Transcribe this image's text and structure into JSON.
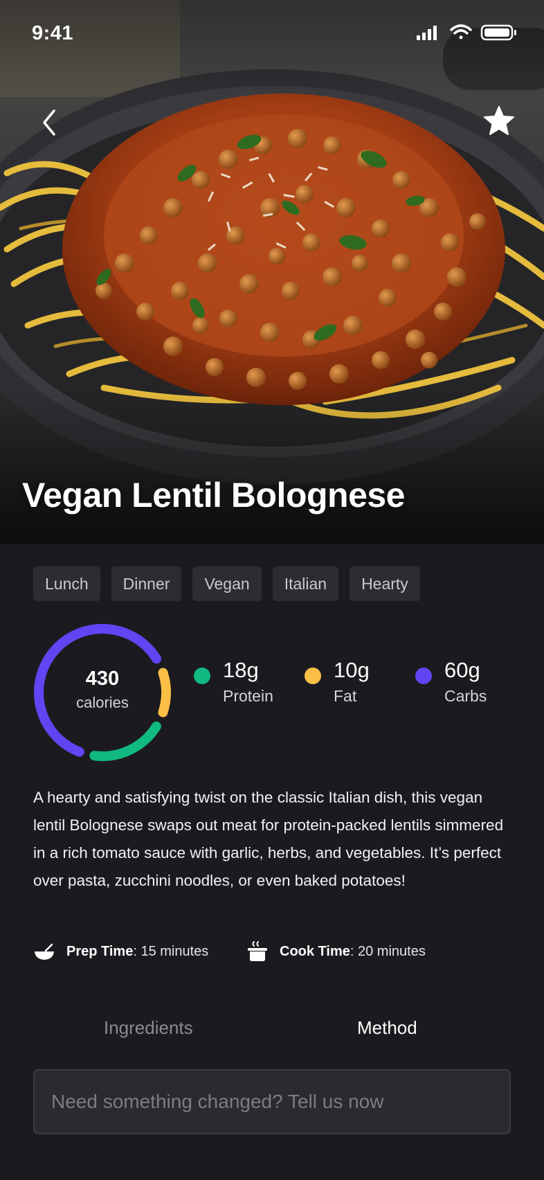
{
  "status_bar": {
    "time": "9:41",
    "icons": [
      "signal-icon",
      "wifi-icon",
      "battery-icon"
    ]
  },
  "header": {
    "back_icon": "chevron-left-icon",
    "favorite_icon": "star-icon"
  },
  "recipe": {
    "title": "Vegan Lentil Bolognese",
    "tags": [
      "Lunch",
      "Dinner",
      "Vegan",
      "Italian",
      "Hearty"
    ],
    "calories": {
      "value": "430",
      "label": "calories"
    },
    "macros": [
      {
        "amount": "18g",
        "name": "Protein",
        "color": "#10b981",
        "ring_fraction": 0.18
      },
      {
        "amount": "10g",
        "name": "Fat",
        "color": "#fbbf46",
        "ring_fraction": 0.1
      },
      {
        "amount": "60g",
        "name": "Carbs",
        "color": "#6244f2",
        "ring_fraction": 0.6
      }
    ],
    "description": "A hearty and satisfying twist on the classic Italian dish, this vegan lentil Bolognese swaps out meat for protein-packed lentils simmered in a rich tomato sauce with garlic, herbs, and vegetables. It’s perfect over pasta, zucchini noodles, or even baked potatoes!",
    "prep_time": {
      "label": "Prep Time",
      "value": ": 15 minutes",
      "icon": "bowl-icon"
    },
    "cook_time": {
      "label": "Cook Time",
      "value": ": 20 minutes",
      "icon": "steaming-pot-icon"
    }
  },
  "tabs": [
    {
      "label": "Ingredients",
      "active": false
    },
    {
      "label": "Method",
      "active": true
    }
  ],
  "feedback": {
    "placeholder": "Need something changed? Tell us now",
    "value": ""
  },
  "colors": {
    "background": "#1b1b1f",
    "tag_background": "#2c2c31",
    "protein": "#10b981",
    "fat": "#fbbf46",
    "carbs": "#6244f2"
  }
}
